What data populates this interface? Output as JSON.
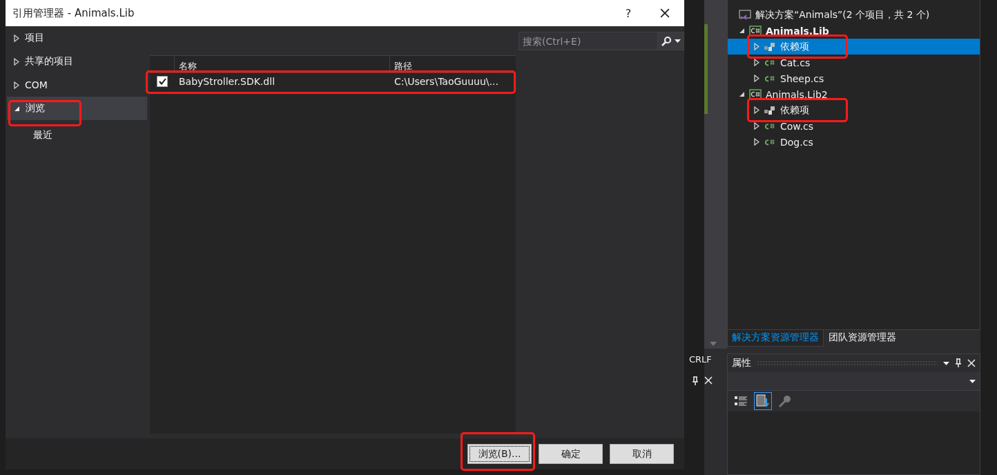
{
  "dialog": {
    "title": "引用管理器 - Animals.Lib",
    "help": "?",
    "nav": [
      {
        "label": "项目",
        "expanded": false,
        "selected": false,
        "highlighted": false
      },
      {
        "label": "共享的项目",
        "expanded": false,
        "selected": false,
        "highlighted": false
      },
      {
        "label": "COM",
        "expanded": false,
        "selected": false,
        "highlighted": false
      },
      {
        "label": "浏览",
        "expanded": true,
        "selected": true,
        "highlighted": true,
        "children": [
          {
            "label": "最近",
            "selected": false
          }
        ]
      }
    ],
    "table": {
      "columns": [
        "名称",
        "路径"
      ],
      "rows": [
        {
          "checked": true,
          "name": "BabyStroller.SDK.dll",
          "path": "C:\\Users\\TaoGuuuu\\...",
          "highlighted": true
        }
      ]
    },
    "search": {
      "placeholder": "搜索(Ctrl+E)"
    },
    "buttons": [
      {
        "label": "浏览(B)...",
        "focused": true,
        "highlighted": true
      },
      {
        "label": "确定",
        "focused": false,
        "highlighted": false
      },
      {
        "label": "取消",
        "focused": false,
        "highlighted": false
      }
    ]
  },
  "solution_explorer": {
    "tree": [
      {
        "kind": "solution",
        "label": "解决方案“Animals”(2 个项目，共 2 个)",
        "children": [
          {
            "kind": "project",
            "label": "Animals.Lib",
            "expanded": true,
            "children": [
              {
                "kind": "dependencies",
                "label": "依赖项",
                "expanded": false,
                "selected": true,
                "highlighted": true
              },
              {
                "kind": "file",
                "label": "Cat.cs",
                "expanded": false,
                "selected": false,
                "highlighted": false
              },
              {
                "kind": "file",
                "label": "Sheep.cs",
                "expanded": false,
                "selected": false,
                "highlighted": false
              }
            ]
          },
          {
            "kind": "project",
            "label": "Animals.Lib2",
            "expanded": true,
            "children": [
              {
                "kind": "dependencies",
                "label": "依赖项",
                "expanded": false,
                "selected": false,
                "highlighted": true
              },
              {
                "kind": "file",
                "label": "Cow.cs",
                "expanded": false,
                "selected": false,
                "highlighted": false
              },
              {
                "kind": "file",
                "label": "Dog.cs",
                "expanded": false,
                "selected": false,
                "highlighted": false
              }
            ]
          }
        ]
      }
    ],
    "tabs": [
      {
        "label": "解决方案资源管理器",
        "selected": true
      },
      {
        "label": "团队资源管理器",
        "selected": false
      }
    ]
  },
  "status": {
    "line_ending": "CRLF"
  },
  "properties": {
    "title": "属性"
  }
}
